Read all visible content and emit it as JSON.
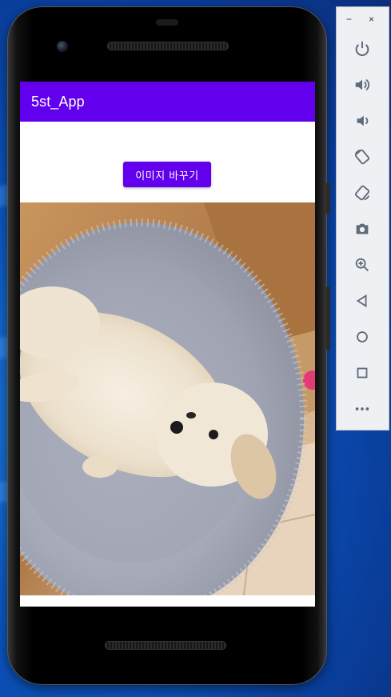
{
  "app": {
    "title": "5st_App"
  },
  "main": {
    "change_image_button": "이미지 바꾸기"
  },
  "toolbar": {
    "minimize": "−",
    "close": "×",
    "items": [
      {
        "name": "power-icon"
      },
      {
        "name": "volume-up-icon"
      },
      {
        "name": "volume-down-icon"
      },
      {
        "name": "rotate-left-icon"
      },
      {
        "name": "rotate-right-icon"
      },
      {
        "name": "camera-icon"
      },
      {
        "name": "zoom-icon"
      },
      {
        "name": "back-icon"
      },
      {
        "name": "home-icon"
      },
      {
        "name": "overview-icon"
      },
      {
        "name": "more-icon"
      }
    ]
  },
  "colors": {
    "accent": "#6200ee",
    "desktop": "#0b58c2"
  }
}
